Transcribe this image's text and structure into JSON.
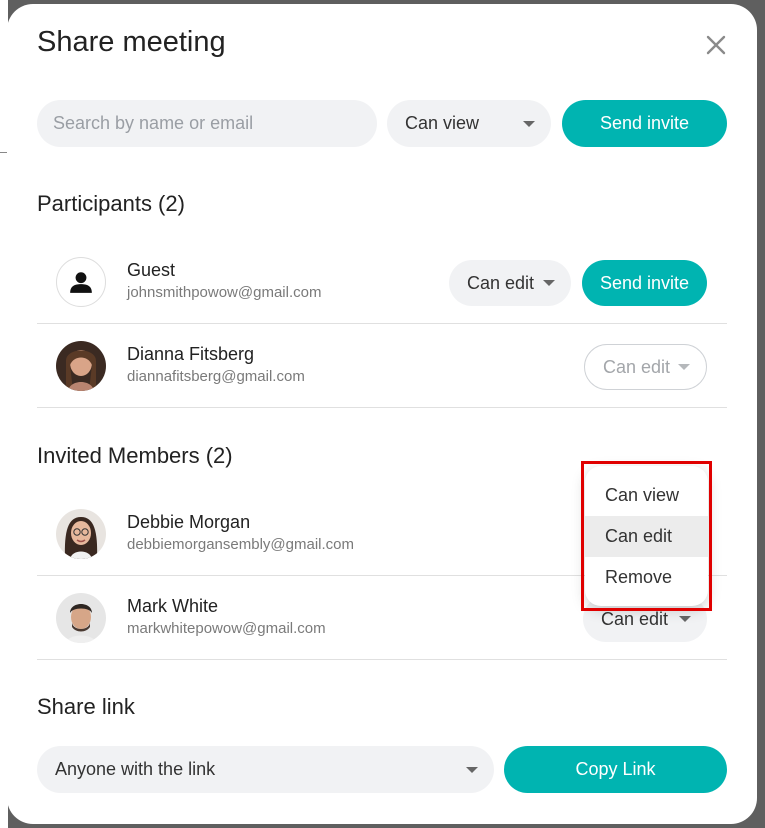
{
  "dialog": {
    "title": "Share meeting"
  },
  "invite_bar": {
    "search_placeholder": "Search by name or email",
    "permission": "Can view",
    "send_label": "Send invite"
  },
  "participants": {
    "heading": "Participants (2)",
    "items": [
      {
        "name": "Guest",
        "email": "johnsmithpowow@gmail.com",
        "permission": "Can edit",
        "action": "Send invite"
      },
      {
        "name": "Dianna Fitsberg",
        "email": "diannafitsberg@gmail.com",
        "permission": "Can edit"
      }
    ]
  },
  "invited": {
    "heading": "Invited Members (2)",
    "items": [
      {
        "name": "Debbie Morgan",
        "email": "debbiemorgansembly@gmail.com"
      },
      {
        "name": "Mark White",
        "email": "markwhitepowow@gmail.com",
        "permission": "Can edit"
      }
    ]
  },
  "dropdown": {
    "options": [
      "Can view",
      "Can edit",
      "Remove"
    ],
    "selected": "Can edit"
  },
  "share_link": {
    "heading": "Share link",
    "access": "Anyone with the link",
    "copy_label": "Copy Link"
  },
  "colors": {
    "accent": "#00b4b1",
    "highlight": "#e00000"
  }
}
